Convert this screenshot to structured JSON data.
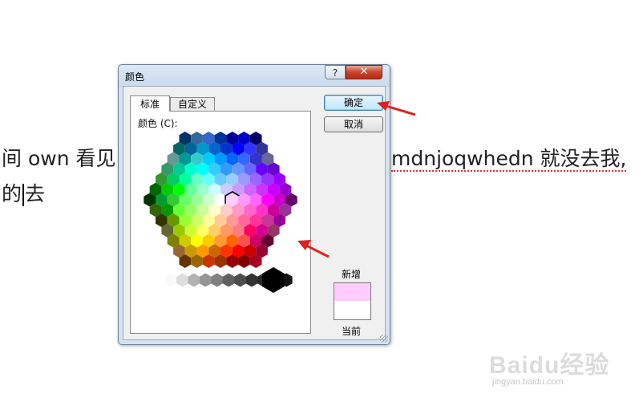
{
  "document": {
    "line1_left": "间 own 看见",
    "line1_right": "mdnjoqwhedn 就没去我,",
    "line2_a": "的",
    "line2_b": "去"
  },
  "dialog": {
    "title": "颜色",
    "help_label": "?",
    "close_label": "✕",
    "tabs": [
      {
        "label": "标准",
        "selected": true
      },
      {
        "label": "自定义",
        "selected": false
      }
    ],
    "colors_label": "颜色 (C):",
    "ok_label": "确定",
    "cancel_label": "取消",
    "new_label": "新增",
    "current_label": "当前",
    "new_color": "#ffccff",
    "current_color": "#ffffff"
  },
  "palette": {
    "hex_rows": [
      [
        "#003366",
        "#336699",
        "#3366cc",
        "#003399",
        "#000099",
        "#0000cc",
        "#000066"
      ],
      [
        "#006666",
        "#006699",
        "#0099cc",
        "#0066cc",
        "#0033cc",
        "#0000ff",
        "#3333ff",
        "#333399"
      ],
      [
        "#669999",
        "#009999",
        "#33cccc",
        "#00ccff",
        "#0099ff",
        "#0066ff",
        "#3366ff",
        "#3333cc",
        "#666699"
      ],
      [
        "#339966",
        "#00cc99",
        "#00ffcc",
        "#00ffff",
        "#33ccff",
        "#3399ff",
        "#6699ff",
        "#6666ff",
        "#6600ff",
        "#6600cc"
      ],
      [
        "#339933",
        "#00cc66",
        "#00ff99",
        "#66ffcc",
        "#66ffff",
        "#66ccff",
        "#99ccff",
        "#9999ff",
        "#9966ff",
        "#9933ff",
        "#9900ff"
      ],
      [
        "#006600",
        "#00cc00",
        "#00ff00",
        "#66ff99",
        "#99ffcc",
        "#ccffff",
        "#ccccff",
        "#cc99ff",
        "#cc66ff",
        "#cc33ff",
        "#cc00ff",
        "#9900cc"
      ],
      [
        "#003300",
        "#009933",
        "#33cc33",
        "#66ff66",
        "#99ff99",
        "#ccffcc",
        "#ffffff",
        "#ffccff",
        "#ff99ff",
        "#ff66ff",
        "#ff00ff",
        "#cc00cc",
        "#660066"
      ],
      [
        "#336600",
        "#009900",
        "#66ff33",
        "#99ff66",
        "#ccff99",
        "#ffffcc",
        "#ffcccc",
        "#ff99cc",
        "#ff66cc",
        "#ff33cc",
        "#cc0099",
        "#993399"
      ],
      [
        "#333300",
        "#669900",
        "#99ff33",
        "#ccff66",
        "#ffff99",
        "#ffcc99",
        "#ff9999",
        "#ff6699",
        "#ff3399",
        "#cc3399",
        "#990099"
      ],
      [
        "#666633",
        "#99cc00",
        "#ccff33",
        "#ffff66",
        "#ffcc66",
        "#ff9966",
        "#ff7c80",
        "#ff0066",
        "#d60093",
        "#993366"
      ],
      [
        "#808000",
        "#cccc00",
        "#ffff00",
        "#ffcc00",
        "#ff9933",
        "#ff6600",
        "#ff5050",
        "#cc0066",
        "#660033"
      ],
      [
        "#996633",
        "#cc9900",
        "#ff9900",
        "#cc6600",
        "#ff3300",
        "#ff0000",
        "#cc0000",
        "#990033"
      ],
      [
        "#663300",
        "#996600",
        "#cc3300",
        "#993300",
        "#990000",
        "#800000",
        "#a50021"
      ]
    ],
    "gray_row": [
      "#f8f8f8",
      "#dddddd",
      "#b2b2b2",
      "#969696",
      "#808080",
      "#5f5f5f",
      "#4d4d4d",
      "#333333",
      "#292929",
      "#1c1c1c",
      "#111111"
    ],
    "big_black": "#000000",
    "big_white": "#ffffff"
  },
  "annotations": {
    "arrow_color": "#e02020"
  },
  "watermark": {
    "brand": "Baidu经验",
    "url": "jingyan.baidu.com"
  }
}
